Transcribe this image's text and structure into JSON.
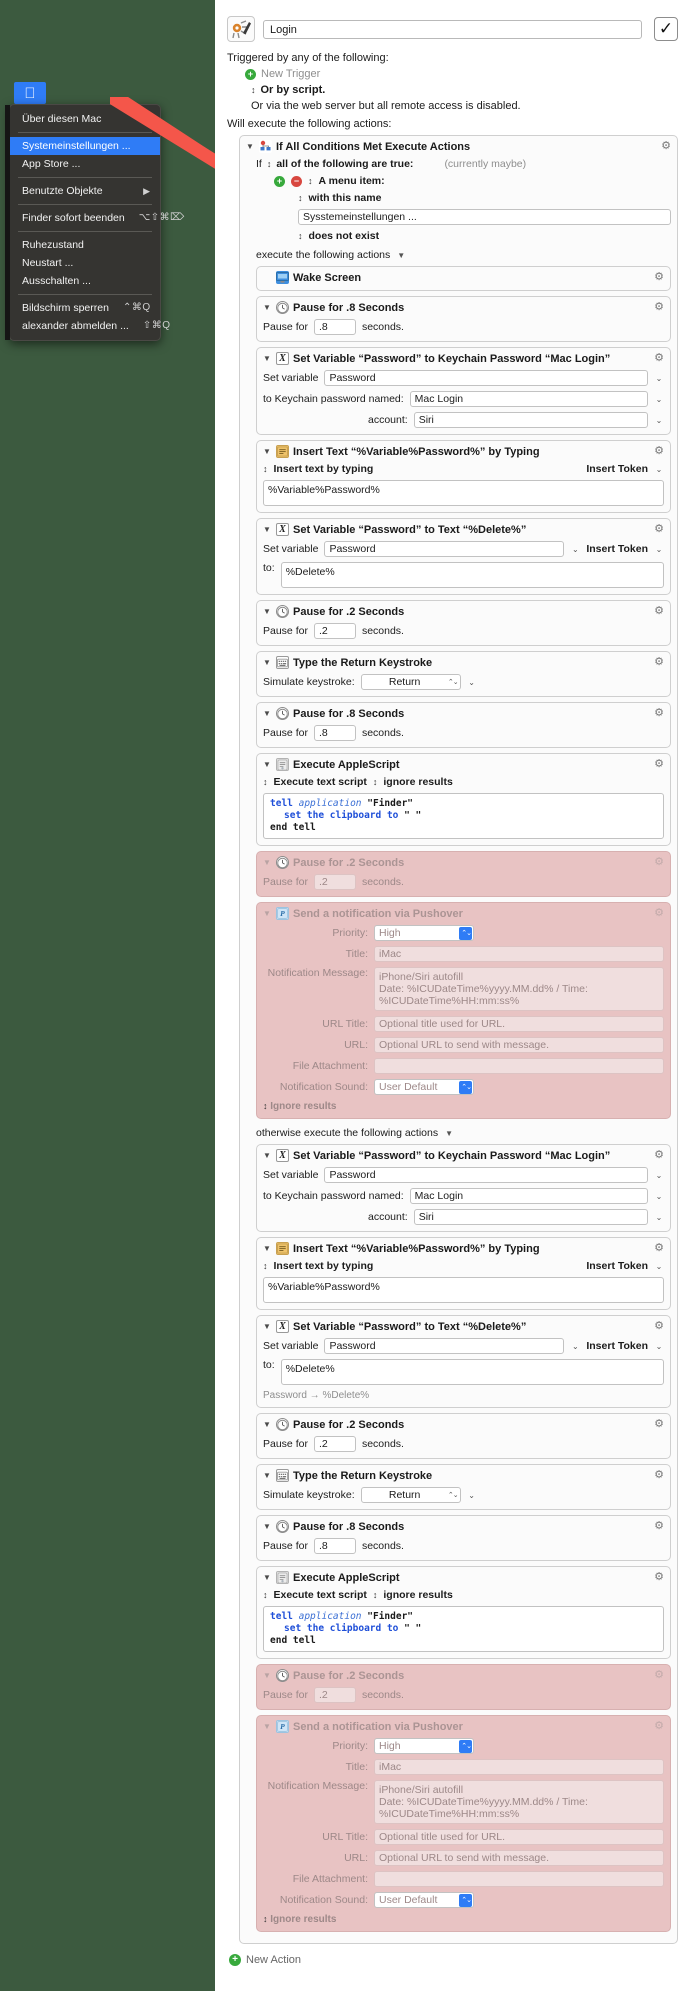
{
  "apple_menu": {
    "apple_icon": "apple-logo",
    "items": [
      {
        "label": "Über diesen Mac",
        "shortcut": "",
        "selected": false,
        "submenu": false
      },
      {
        "sep": true
      },
      {
        "label": "Systemeinstellungen ...",
        "shortcut": "",
        "selected": true,
        "submenu": false
      },
      {
        "label": "App Store ...",
        "shortcut": "",
        "selected": false,
        "submenu": false
      },
      {
        "sep": true
      },
      {
        "label": "Benutzte Objekte",
        "shortcut": "",
        "selected": false,
        "submenu": true
      },
      {
        "sep": true
      },
      {
        "label": "Finder sofort beenden",
        "shortcut": "⌥⇧⌘⌦",
        "selected": false,
        "submenu": false
      },
      {
        "sep": true
      },
      {
        "label": "Ruhezustand",
        "shortcut": "",
        "selected": false,
        "submenu": false
      },
      {
        "label": "Neustart ...",
        "shortcut": "",
        "selected": false,
        "submenu": false
      },
      {
        "label": "Ausschalten ...",
        "shortcut": "",
        "selected": false,
        "submenu": false
      },
      {
        "sep": true
      },
      {
        "label": "Bildschirm sperren",
        "shortcut": "⌃⌘Q",
        "selected": false,
        "submenu": false
      },
      {
        "label": "alexander  abmelden ...",
        "shortcut": "⇧⌘Q",
        "selected": false,
        "submenu": false
      }
    ]
  },
  "editor": {
    "macro_icon": "macro-gear-pencil-icon",
    "macro_name": "Login",
    "enabled_checkbox": "✓",
    "triggered_by_label": "Triggered by any of the following:",
    "new_trigger_label": "New Trigger",
    "or_by_script": "Or by script.",
    "web_server_note": "Or via the web server but all remote access is disabled.",
    "will_execute_label": "Will execute the following actions:",
    "new_action_label": "New Action",
    "condition": {
      "title": "If All Conditions Met Execute Actions",
      "if_label": "If",
      "all_of_label": "all of the following are true:",
      "currently_note": "(currently maybe)",
      "menu_item_label": "A menu item:",
      "with_this_name_label": "with this name",
      "menu_name_value": "Sysstemeinstellungen ...",
      "does_not_exist_label": "does not exist",
      "execute_actions_label": "execute the following actions",
      "otherwise_label": "otherwise execute the following actions"
    },
    "then_actions": [
      {
        "type": "wake",
        "title": "Wake Screen",
        "icon": "display-icon",
        "has_disclosure": false,
        "has_gear": true
      },
      {
        "type": "pause",
        "title": "Pause for .8 Seconds",
        "icon": "clock-icon",
        "pause_label": "Pause for",
        "pause_value": ".8",
        "seconds_label": "seconds."
      },
      {
        "type": "setvar_keychain",
        "title": "Set Variable “Password” to Keychain Password “Mac Login”",
        "icon": "variable-x-icon",
        "set_variable_label": "Set variable",
        "variable_value": "Password",
        "keychain_label": "to Keychain password named:",
        "keychain_value": "Mac Login",
        "account_label": "account:",
        "account_value": "Siri"
      },
      {
        "type": "insert_text",
        "title": "Insert Text “%Variable%Password%” by Typing",
        "icon": "text-icon",
        "mode_label": "Insert text by typing",
        "insert_token_label": "Insert Token",
        "text_value": "%Variable%Password%"
      },
      {
        "type": "setvar_text",
        "title": "Set Variable “Password” to Text “%Delete%”",
        "icon": "variable-x-icon",
        "set_variable_label": "Set variable",
        "variable_value": "Password",
        "insert_token_label": "Insert Token",
        "to_label": "to:",
        "to_value": "%Delete%"
      },
      {
        "type": "pause",
        "title": "Pause for .2 Seconds",
        "icon": "clock-icon",
        "pause_label": "Pause for",
        "pause_value": ".2",
        "seconds_label": "seconds."
      },
      {
        "type": "keystroke",
        "title": "Type the Return Keystroke",
        "icon": "keyboard-icon",
        "simulate_label": "Simulate keystroke:",
        "keystroke_value": "Return"
      },
      {
        "type": "pause",
        "title": "Pause for .8 Seconds",
        "icon": "clock-icon",
        "pause_label": "Pause for",
        "pause_value": ".8",
        "seconds_label": "seconds."
      },
      {
        "type": "applescript",
        "title": "Execute AppleScript",
        "icon": "script-icon",
        "mode_label": "Execute text script",
        "results_label": "ignore results",
        "script_line1_kw": "tell",
        "script_line1_app": "application",
        "script_line1_target": "\"Finder\"",
        "script_line2": "set the clipboard to",
        "script_line2_arg": "\" \"",
        "script_line3": "end tell"
      },
      {
        "type": "pause",
        "title": "Pause for .2 Seconds",
        "icon": "clock-icon",
        "pause_label": "Pause for",
        "pause_value": ".2",
        "seconds_label": "seconds.",
        "disabled": true
      },
      {
        "type": "pushover",
        "title": "Send a notification via Pushover",
        "icon": "pushover-icon",
        "disabled": true,
        "priority_label": "Priority:",
        "priority_value": "High",
        "title_label": "Title:",
        "title_value": "iMac",
        "message_label": "Notification Message:",
        "message_value": "iPhone/Siri autofill\nDate: %ICUDateTime%yyyy.MM.dd% / Time: %ICUDateTime%HH:mm:ss%",
        "url_title_label": "URL Title:",
        "url_title_placeholder": "Optional title used for URL.",
        "url_label": "URL:",
        "url_placeholder": "Optional URL to send with message.",
        "file_label": "File Attachment:",
        "file_value": "",
        "sound_label": "Notification Sound:",
        "sound_value": "User Default",
        "ignore_results_label": "Ignore results"
      }
    ],
    "else_actions": [
      {
        "type": "setvar_keychain",
        "title": "Set Variable “Password” to Keychain Password “Mac Login”",
        "icon": "variable-x-icon",
        "set_variable_label": "Set variable",
        "variable_value": "Password",
        "keychain_label": "to Keychain password named:",
        "keychain_value": "Mac Login",
        "account_label": "account:",
        "account_value": "Siri"
      },
      {
        "type": "insert_text",
        "title": "Insert Text “%Variable%Password%” by Typing",
        "icon": "text-icon",
        "mode_label": "Insert text by typing",
        "insert_token_label": "Insert Token",
        "text_value": "%Variable%Password%"
      },
      {
        "type": "setvar_text",
        "title": "Set Variable “Password” to Text “%Delete%”",
        "icon": "variable-x-icon",
        "set_variable_label": "Set variable",
        "variable_value": "Password",
        "insert_token_label": "Insert Token",
        "to_label": "to:",
        "to_value": "%Delete%",
        "result_note": "Password → %Delete%"
      },
      {
        "type": "pause",
        "title": "Pause for .2 Seconds",
        "icon": "clock-icon",
        "pause_label": "Pause for",
        "pause_value": ".2",
        "seconds_label": "seconds."
      },
      {
        "type": "keystroke",
        "title": "Type the Return Keystroke",
        "icon": "keyboard-icon",
        "simulate_label": "Simulate keystroke:",
        "keystroke_value": "Return"
      },
      {
        "type": "pause",
        "title": "Pause for .8 Seconds",
        "icon": "clock-icon",
        "pause_label": "Pause for",
        "pause_value": ".8",
        "seconds_label": "seconds."
      },
      {
        "type": "applescript",
        "title": "Execute AppleScript",
        "icon": "script-icon",
        "mode_label": "Execute text script",
        "results_label": "ignore results",
        "script_line1_kw": "tell",
        "script_line1_app": "application",
        "script_line1_target": "\"Finder\"",
        "script_line2": "set the clipboard to",
        "script_line2_arg": "\" \"",
        "script_line3": "end tell"
      },
      {
        "type": "pause",
        "title": "Pause for .2 Seconds",
        "icon": "clock-icon",
        "pause_label": "Pause for",
        "pause_value": ".2",
        "seconds_label": "seconds.",
        "disabled": true
      },
      {
        "type": "pushover",
        "title": "Send a notification via Pushover",
        "icon": "pushover-icon",
        "disabled": true,
        "priority_label": "Priority:",
        "priority_value": "High",
        "title_label": "Title:",
        "title_value": "iMac",
        "message_label": "Notification Message:",
        "message_value": "iPhone/Siri autofill\nDate: %ICUDateTime%yyyy.MM.dd% / Time: %ICUDateTime%HH:mm:ss%",
        "url_title_label": "URL Title:",
        "url_title_placeholder": "Optional title used for URL.",
        "url_label": "URL:",
        "url_placeholder": "Optional URL to send with message.",
        "file_label": "File Attachment:",
        "file_value": "",
        "sound_label": "Notification Sound:",
        "sound_value": "User Default",
        "ignore_results_label": "Ignore results"
      }
    ]
  },
  "colors": {
    "background": "#3c5a3f",
    "accent_blue": "#2f7cf6",
    "disabled_pink": "#e8c3c3",
    "arrow_red": "#f4564a",
    "green_plus": "#37a93c"
  }
}
